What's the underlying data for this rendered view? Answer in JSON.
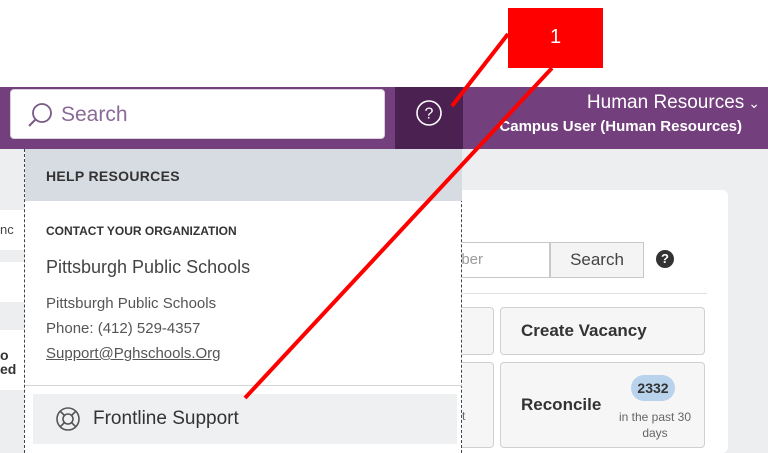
{
  "header": {
    "search_placeholder": "Search",
    "help_icon": "question-circle-icon",
    "org_name": "Human Resources",
    "org_chevron": "⌄",
    "user_role": "Campus User (Human Resources)",
    "colors": {
      "bar": "#733f7d",
      "help_zone": "#4a2150"
    }
  },
  "help_panel": {
    "heading": "HELP RESOURCES",
    "contact_title": "CONTACT YOUR ORGANIZATION",
    "org": "Pittsburgh Public Schools",
    "address_lines": [
      "Pittsburgh Public Schools",
      "Phone: (412) 529-4357"
    ],
    "email": "Support@Pghschools.Org",
    "frontline_label": "Frontline Support",
    "frontline_icon": "lifebuoy-icon"
  },
  "background": {
    "left_fragment_1": "nc",
    "left_fragment_2": "o\ned",
    "number_input_placeholder_fragment": "nber",
    "search_button": "Search",
    "help_glyph": "?",
    "create_vacancy": "Create Vacancy",
    "partial_sub_fragment": "xt\ns",
    "reconcile_label": "Reconcile",
    "reconcile_count": "2332",
    "reconcile_sub": "in the past 30 days"
  },
  "annotation": {
    "callout_number": "1",
    "callout_color": "#ff0000"
  }
}
